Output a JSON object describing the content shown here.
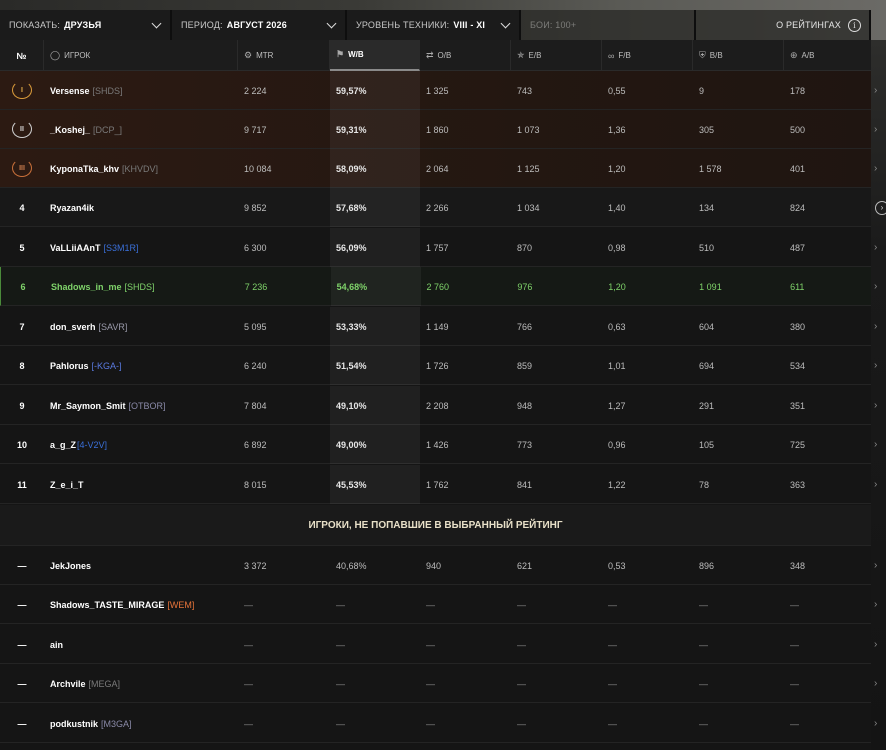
{
  "filters": {
    "show_label": "ПОКАЗАТЬ:",
    "show_value": "ДРУЗЬЯ",
    "period_label": "ПЕРИОД:",
    "period_value": "АВГУСТ 2026",
    "tier_label": "УРОВЕНЬ ТЕХНИКИ:",
    "tier_value": "VIII - XI",
    "battles_label": "БОИ: 100+",
    "rating_label": "О РЕЙТИНГАХ"
  },
  "columns": {
    "rank": "№",
    "player": "ИГРОК",
    "mtr": "MTR",
    "wb": "W/B",
    "ob": "О/B",
    "eb": "E/B",
    "fb": "F/B",
    "bb": "B/B",
    "ab": "A/B"
  },
  "icons": {
    "player": "user-icon",
    "mtr": "gear-icon",
    "wb": "flag-icon",
    "ob": "tank-icon",
    "eb": "star-icon",
    "fb": "tracks-icon",
    "bb": "shield-icon",
    "ab": "crosshair-icon"
  },
  "colors": {
    "me": "#7fd36a",
    "gold": "#e8b04a",
    "silver": "#dcdcdc",
    "bronze": "#d08050"
  },
  "ranked": [
    {
      "rank": "I",
      "name": "Versense",
      "clan": "[SHDS]",
      "clan_color": "#7a7a7a",
      "mtr": "2 224",
      "wb": "59,57%",
      "ob": "1 325",
      "eb": "743",
      "fb": "0,55",
      "bb": "9",
      "ab": "178"
    },
    {
      "rank": "II",
      "name": "_Koshej_",
      "clan": "[DCP_]",
      "clan_color": "#3fa34a",
      "mtr": "9 717",
      "wb": "59,31%",
      "ob": "1 860",
      "eb": "1 073",
      "fb": "1,36",
      "bb": "305",
      "ab": "500"
    },
    {
      "rank": "III",
      "name": "KyponaTka_khv",
      "clan": "[KHVDV]",
      "clan_color": "#6a6a6a",
      "mtr": "10 084",
      "wb": "58,09%",
      "ob": "2 064",
      "eb": "1 125",
      "fb": "1,20",
      "bb": "1 578",
      "ab": "401"
    },
    {
      "rank": "4",
      "name": "Ryazan4ik",
      "clan": "",
      "clan_color": "#7a7a7a",
      "mtr": "9 852",
      "wb": "57,68%",
      "ob": "2 266",
      "eb": "1 034",
      "fb": "1,40",
      "bb": "134",
      "ab": "824"
    },
    {
      "rank": "5",
      "name": "VaLLiiAAnT",
      "clan": "[S3M1R]",
      "clan_color": "#3a6fd8",
      "mtr": "6 300",
      "wb": "56,09%",
      "ob": "1 757",
      "eb": "870",
      "fb": "0,98",
      "bb": "510",
      "ab": "487"
    },
    {
      "rank": "6",
      "name": "Shadows_in_me",
      "clan": "[SHDS]",
      "clan_color": "#7a7a7a",
      "mtr": "7 236",
      "wb": "54,68%",
      "ob": "2 760",
      "eb": "976",
      "fb": "1,20",
      "bb": "1 091",
      "ab": "611"
    },
    {
      "rank": "7",
      "name": "don_sverh",
      "clan": "[SAVR]",
      "clan_color": "#9a9aaa",
      "mtr": "5 095",
      "wb": "53,33%",
      "ob": "1 149",
      "eb": "766",
      "fb": "0,63",
      "bb": "604",
      "ab": "380"
    },
    {
      "rank": "8",
      "name": "Pahlorus",
      "clan": "[-KGA-]",
      "clan_color": "#5a7ae0",
      "mtr": "6 240",
      "wb": "51,54%",
      "ob": "1 726",
      "eb": "859",
      "fb": "1,01",
      "bb": "694",
      "ab": "534"
    },
    {
      "rank": "9",
      "name": "Mr_Saymon_Smit",
      "clan": "[OTBOR]",
      "clan_color": "#8a8aa8",
      "mtr": "7 804",
      "wb": "49,10%",
      "ob": "2 208",
      "eb": "948",
      "fb": "1,27",
      "bb": "291",
      "ab": "351"
    },
    {
      "rank": "10",
      "name": "a_g_Z",
      "clan": "[4-V2V]",
      "clan_color": "#3a6fd8",
      "mtr": "6 892",
      "wb": "49,00%",
      "ob": "1 426",
      "eb": "773",
      "fb": "0,96",
      "bb": "105",
      "ab": "725"
    },
    {
      "rank": "11",
      "name": "Z_e_i_T",
      "clan": "",
      "clan_color": "#7a7a7a",
      "mtr": "8 015",
      "wb": "45,53%",
      "ob": "1 762",
      "eb": "841",
      "fb": "1,22",
      "bb": "78",
      "ab": "363"
    }
  ],
  "section_title": "ИГРОКИ, НЕ ПОПАВШИЕ В ВЫБРАННЫЙ РЕЙТИНГ",
  "unranked": [
    {
      "rank": "—",
      "name": "JekJones",
      "clan": "",
      "clan_color": "#7a7a7a",
      "mtr": "3 372",
      "wb": "40,68%",
      "ob": "940",
      "eb": "621",
      "fb": "0,53",
      "bb": "896",
      "ab": "348"
    },
    {
      "rank": "—",
      "name": "Shadows_TASTE_MIRAGE",
      "clan": "[WEM]",
      "clan_color": "#e8743a",
      "mtr": "—",
      "wb": "—",
      "ob": "—",
      "eb": "—",
      "fb": "—",
      "bb": "—",
      "ab": "—"
    },
    {
      "rank": "—",
      "name": "ain",
      "clan": "",
      "clan_color": "#7a7a7a",
      "mtr": "—",
      "wb": "—",
      "ob": "—",
      "eb": "—",
      "fb": "—",
      "bb": "—",
      "ab": "—"
    },
    {
      "rank": "—",
      "name": "Archvile",
      "clan": "[MEGA]",
      "clan_color": "#6a6a6a",
      "mtr": "—",
      "wb": "—",
      "ob": "—",
      "eb": "—",
      "fb": "—",
      "bb": "—",
      "ab": "—"
    },
    {
      "rank": "—",
      "name": "podkustnik",
      "clan": "[M3GA]",
      "clan_color": "#8a8aa8",
      "mtr": "—",
      "wb": "—",
      "ob": "—",
      "eb": "—",
      "fb": "—",
      "bb": "—",
      "ab": "—"
    }
  ]
}
